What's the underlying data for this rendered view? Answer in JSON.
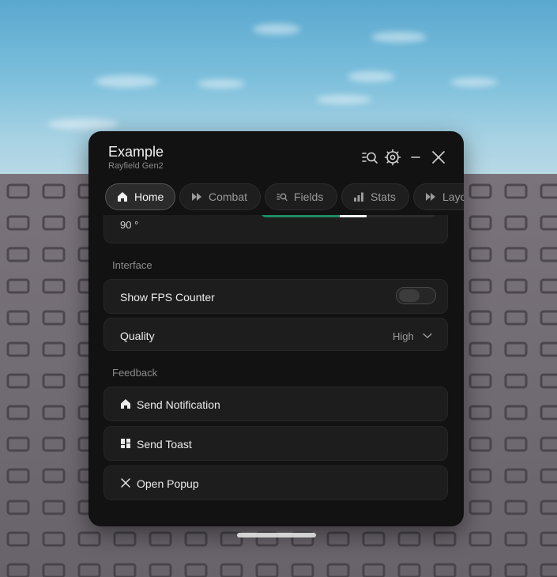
{
  "window": {
    "title": "Example",
    "subtitle": "Rayfield Gen2"
  },
  "header_icons": [
    "search-list-icon",
    "gear-icon",
    "minimize-icon",
    "close-icon"
  ],
  "tabs": [
    {
      "label": "Home",
      "icon": "home-icon",
      "active": true
    },
    {
      "label": "Combat",
      "icon": "fast-forward-icon",
      "active": false
    },
    {
      "label": "Fields",
      "icon": "search-list-icon",
      "active": false
    },
    {
      "label": "Stats",
      "icon": "bar-chart-icon",
      "active": false
    },
    {
      "label": "Layout",
      "icon": "fast-forward-icon",
      "active": false
    }
  ],
  "slider": {
    "value_label": "90 °",
    "fraction": 0.45,
    "fill_color": "#1f8b63"
  },
  "sections": {
    "interface": "Interface",
    "feedback": "Feedback"
  },
  "interface": {
    "fps_counter": {
      "label": "Show FPS Counter",
      "enabled": false
    },
    "quality": {
      "label": "Quality",
      "value": "High"
    }
  },
  "feedback": {
    "notification": {
      "label": "Send Notification",
      "icon": "home-icon"
    },
    "toast": {
      "label": "Send Toast",
      "icon": "layout-icon"
    },
    "popup": {
      "label": "Open Popup",
      "icon": "close-icon"
    }
  },
  "colors": {
    "window_bg": "#121212",
    "card_bg": "#1d1d1d",
    "accent": "#1f8b63"
  }
}
